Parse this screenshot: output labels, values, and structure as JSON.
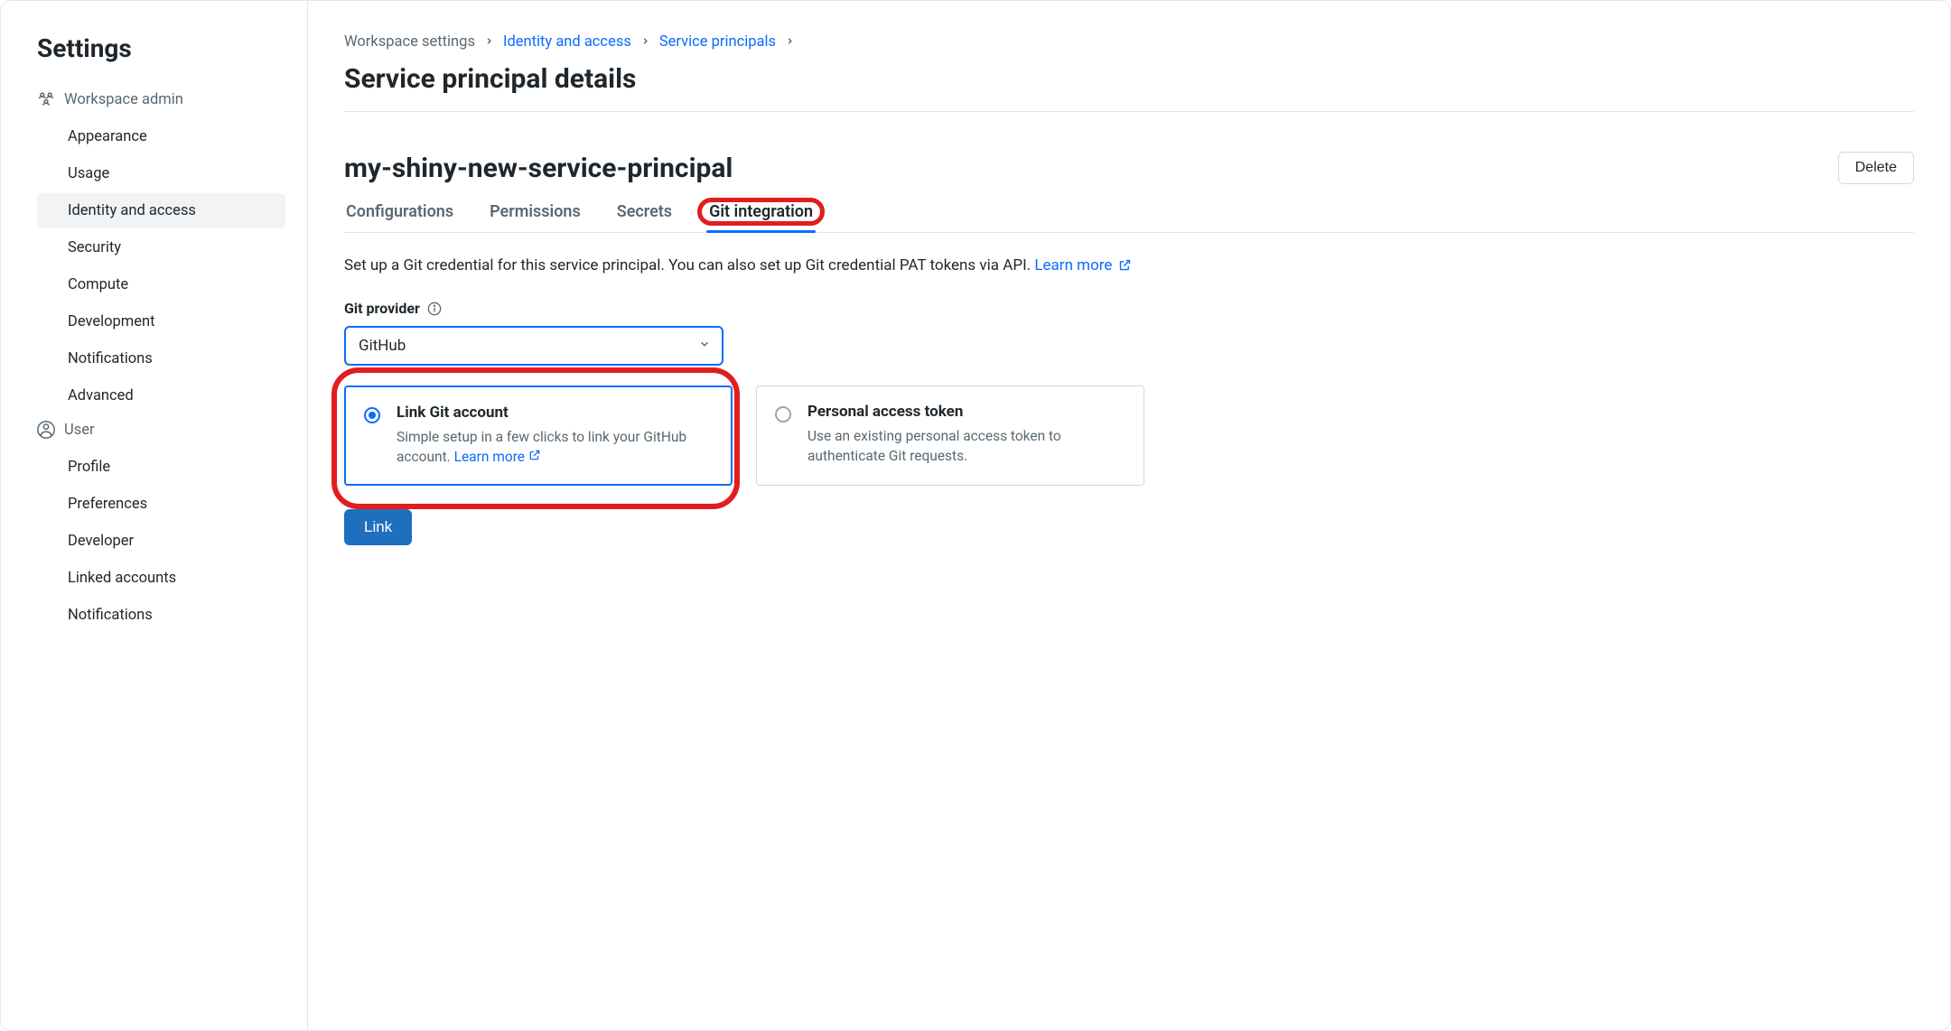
{
  "sidebar": {
    "title": "Settings",
    "sections": [
      {
        "header": "Workspace admin",
        "iconName": "workspace-admin-icon",
        "items": [
          {
            "label": "Appearance",
            "active": false
          },
          {
            "label": "Usage",
            "active": false
          },
          {
            "label": "Identity and access",
            "active": true
          },
          {
            "label": "Security",
            "active": false
          },
          {
            "label": "Compute",
            "active": false
          },
          {
            "label": "Development",
            "active": false
          },
          {
            "label": "Notifications",
            "active": false
          },
          {
            "label": "Advanced",
            "active": false
          }
        ]
      },
      {
        "header": "User",
        "iconName": "user-icon",
        "items": [
          {
            "label": "Profile",
            "active": false
          },
          {
            "label": "Preferences",
            "active": false
          },
          {
            "label": "Developer",
            "active": false
          },
          {
            "label": "Linked accounts",
            "active": false
          },
          {
            "label": "Notifications",
            "active": false
          }
        ]
      }
    ]
  },
  "breadcrumb": {
    "items": [
      {
        "label": "Workspace settings",
        "link": false
      },
      {
        "label": "Identity and access",
        "link": true
      },
      {
        "label": "Service principals",
        "link": true
      }
    ]
  },
  "page": {
    "title": "Service principal details",
    "entityName": "my-shiny-new-service-principal",
    "deleteLabel": "Delete"
  },
  "tabs": [
    {
      "label": "Configurations",
      "active": false,
      "highlight": false
    },
    {
      "label": "Permissions",
      "active": false,
      "highlight": false
    },
    {
      "label": "Secrets",
      "active": false,
      "highlight": false
    },
    {
      "label": "Git integration",
      "active": true,
      "highlight": true
    }
  ],
  "description": {
    "text": "Set up a Git credential for this service principal. You can also set up Git credential PAT tokens via API. ",
    "learnMore": "Learn more"
  },
  "form": {
    "providerLabel": "Git provider",
    "providerValue": "GitHub",
    "options": [
      {
        "title": "Link Git account",
        "desc": "Simple setup in a few clicks to link your GitHub account. ",
        "learnMore": "Learn more",
        "selected": true,
        "highlight": true
      },
      {
        "title": "Personal access token",
        "desc": "Use an existing personal access token to authenticate Git requests.",
        "learnMore": "",
        "selected": false,
        "highlight": false
      }
    ],
    "submitLabel": "Link"
  }
}
